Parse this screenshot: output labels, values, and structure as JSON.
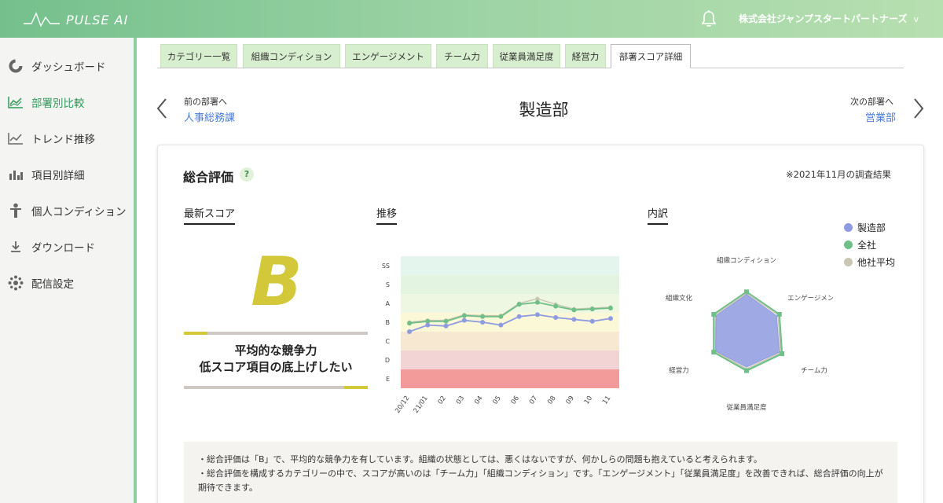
{
  "app": {
    "name": "PULSE AI",
    "company": "株式会社ジャンプスタートパートナーズ",
    "company_chevron": "v"
  },
  "sidebar": {
    "items": [
      {
        "label": "ダッシュボード",
        "icon": "donut-chart-icon",
        "active": false
      },
      {
        "label": "部署別比較",
        "icon": "line-chart-icon",
        "active": true
      },
      {
        "label": "トレンド推移",
        "icon": "trend-chart-icon",
        "active": false
      },
      {
        "label": "項目別詳細",
        "icon": "bar-chart-icon",
        "active": false
      },
      {
        "label": "個人コンディション",
        "icon": "person-icon",
        "active": false
      },
      {
        "label": "ダウンロード",
        "icon": "download-icon",
        "active": false
      },
      {
        "label": "配信設定",
        "icon": "gear-icon",
        "active": false
      }
    ]
  },
  "tabs": [
    {
      "label": "カテゴリー一覧",
      "active": false
    },
    {
      "label": "組織コンディション",
      "active": false
    },
    {
      "label": "エンゲージメント",
      "active": false
    },
    {
      "label": "チーム力",
      "active": false
    },
    {
      "label": "従業員満足度",
      "active": false
    },
    {
      "label": "経営力",
      "active": false
    },
    {
      "label": "部署スコア詳細",
      "active": true
    }
  ],
  "dept_nav": {
    "prev_caption": "前の部署へ",
    "prev_name": "人事総務課",
    "title": "製造部",
    "next_caption": "次の部署へ",
    "next_name": "営業部"
  },
  "card": {
    "title": "総合評価",
    "help": "?",
    "survey_note": "※2021年11月の調査結果",
    "sections": {
      "latest": "最新スコア",
      "trend": "推移",
      "breakdown": "内訳"
    },
    "grade": "B",
    "grade_message_1": "平均的な競争力",
    "grade_message_2": "低スコア項目の底上げしたい"
  },
  "comment": {
    "line1": "・総合評価は「B」で、平均的な競争力を有しています。組織の状態としては、悪くはないですが、何かしらの問題も抱えていると考えられます。",
    "line2": "・総合評価を構成するカテゴリーの中で、スコアが高いのは「チーム力」「組織コンディション」です。「エンゲージメント」「従業員満足度」を改善できれば、総合評価の向上が期待できます。"
  },
  "colors": {
    "accent": "#2f9a5a",
    "dept": "#8e9be0",
    "company": "#6fbf88",
    "industry": "#c9c6b4",
    "grade": "#d2c83a"
  },
  "chart_data": [
    {
      "type": "line",
      "x": [
        "20/12",
        "21/01",
        "02",
        "03",
        "04",
        "05",
        "06",
        "07",
        "08",
        "09",
        "10",
        "11"
      ],
      "y_categories": [
        "E",
        "D",
        "C",
        "B",
        "A",
        "S",
        "SS"
      ],
      "ylim": [
        0,
        7
      ],
      "series": [
        {
          "name": "製造部",
          "values": [
            3.0,
            3.35,
            3.3,
            3.6,
            3.5,
            3.35,
            3.8,
            3.9,
            3.75,
            3.65,
            3.55,
            3.7
          ]
        },
        {
          "name": "全社",
          "values": [
            3.45,
            3.55,
            3.55,
            3.85,
            3.8,
            3.8,
            4.45,
            4.55,
            4.35,
            4.15,
            4.2,
            4.25
          ]
        },
        {
          "name": "他社平均",
          "values": [
            3.5,
            3.6,
            3.6,
            3.9,
            3.85,
            3.85,
            4.5,
            4.75,
            4.45,
            4.2,
            4.25,
            4.3
          ]
        }
      ]
    },
    {
      "type": "radar",
      "categories": [
        "組織コンディション",
        "エンゲージメント",
        "チーム力",
        "従業員満足度",
        "経営力",
        "組織文化"
      ],
      "max": 10,
      "series": [
        {
          "name": "製造部",
          "values": [
            8.8,
            7.9,
            8.6,
            7.7,
            8.1,
            8.0
          ]
        },
        {
          "name": "全社",
          "values": [
            9.4,
            8.6,
            9.3,
            8.5,
            8.6,
            8.6
          ]
        },
        {
          "name": "他社平均",
          "values": [
            9.1,
            8.3,
            8.9,
            8.1,
            8.3,
            8.3
          ]
        }
      ]
    }
  ]
}
